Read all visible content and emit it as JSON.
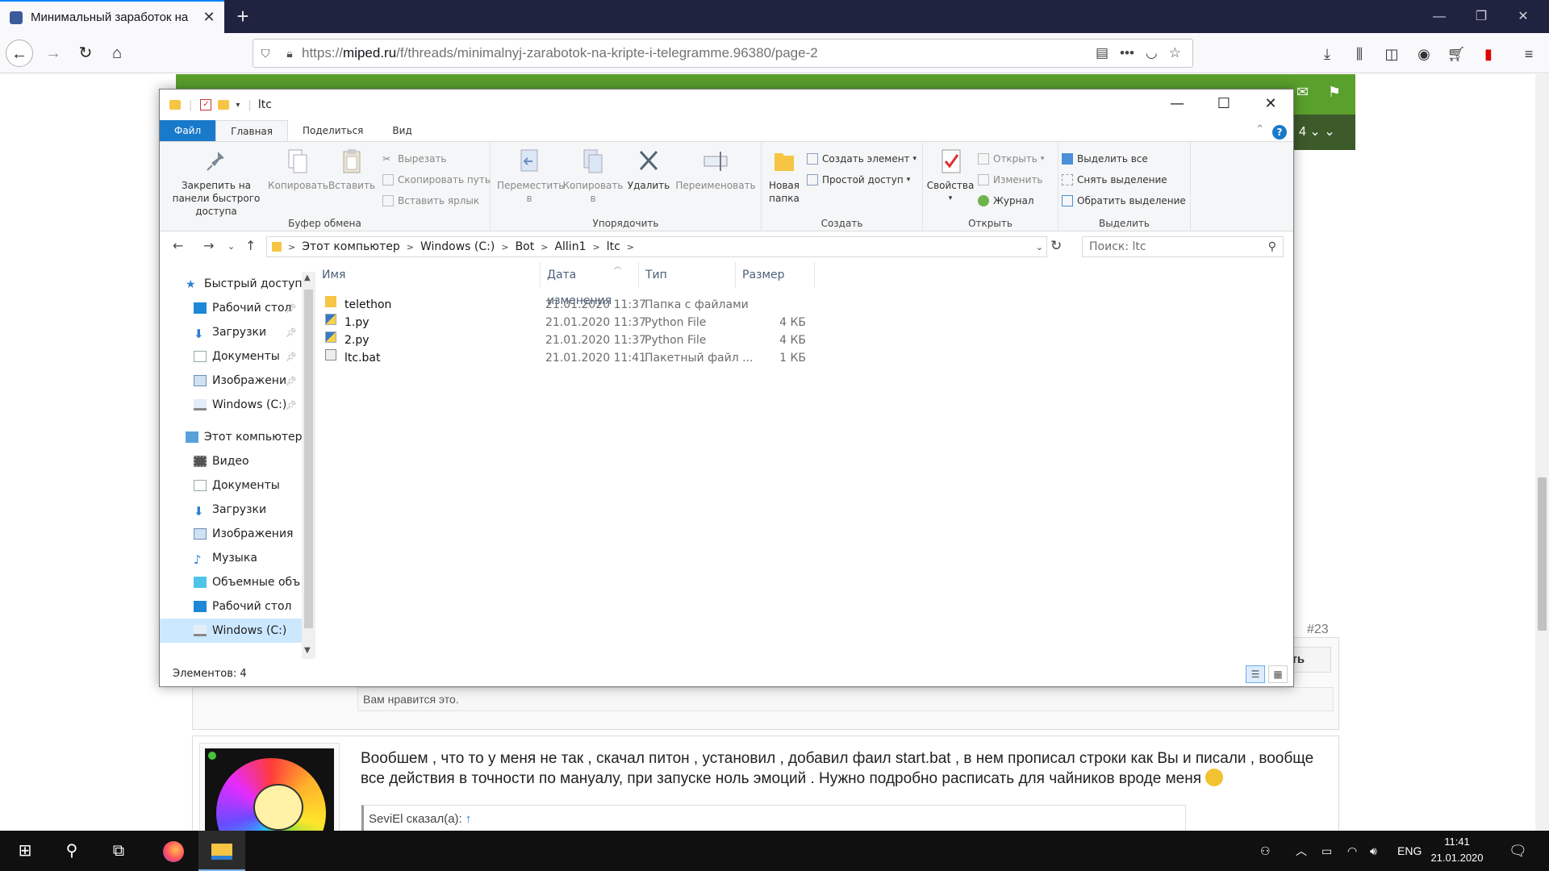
{
  "browser": {
    "tab_title": "Минимальный заработок на",
    "url_scheme": "https://",
    "url_host": "miped.ru",
    "url_path": "/f/threads/minimalnyj-zarabotok-na-kripte-i-telegramme.96380/page-2",
    "accent_color": "#0a84ff"
  },
  "webpage": {
    "pagination": "4",
    "post_number": "#23",
    "reply_label": "тить",
    "likes_text": "Вам нравится это.",
    "post_text": "Вообшем , что то у меня не так , скачал питон , установил , добавил фаил start.bat , в нем прописал строки как Вы и писали , вообще все действия в точности по мануалу, при запуске ноль эмоций . Нужно подробно расписать для чайников вроде меня",
    "quote_author": "SeviEl сказал(а):",
    "quote_arrow": "↑",
    "forum_green": "#5aa02c"
  },
  "explorer": {
    "title": "ltc",
    "tabs": [
      "Файл",
      "Главная",
      "Поделиться",
      "Вид"
    ],
    "ribbon": {
      "clipboard": {
        "label": "Буфер обмена",
        "pin": "Закрепить на панели быстрого доступа",
        "copy": "Копировать",
        "paste": "Вставить",
        "cut": "Вырезать",
        "copy_path": "Скопировать путь",
        "paste_shortcut": "Вставить ярлык"
      },
      "organize": {
        "label": "Упорядочить",
        "move": "Переместить в",
        "copy_to": "Копировать в",
        "delete": "Удалить",
        "rename": "Переименовать"
      },
      "create": {
        "label": "Создать",
        "new_folder": "Новая папка",
        "new_item": "Создать элемент",
        "easy_access": "Простой доступ"
      },
      "open": {
        "label": "Открыть",
        "properties": "Свойства",
        "open": "Открыть",
        "edit": "Изменить",
        "history": "Журнал"
      },
      "select": {
        "label": "Выделить",
        "select_all": "Выделить все",
        "select_none": "Снять выделение",
        "invert": "Обратить выделение"
      }
    },
    "breadcrumb": [
      "Этот компьютер",
      "Windows (C:)",
      "Bot",
      "Allin1",
      "ltc"
    ],
    "search_placeholder": "Поиск: ltc",
    "nav": {
      "quick_access": "Быстрый доступ",
      "quick_items": [
        "Рабочий стол",
        "Загрузки",
        "Документы",
        "Изображени",
        "Windows (C:)"
      ],
      "this_pc": "Этот компьютер",
      "pc_items": [
        "Видео",
        "Документы",
        "Загрузки",
        "Изображения",
        "Музыка",
        "Объемные объ",
        "Рабочий стол",
        "Windows (C:)"
      ]
    },
    "columns": [
      "Имя",
      "Дата изменения",
      "Тип",
      "Размер"
    ],
    "files": [
      {
        "name": "telethon",
        "date": "21.01.2020 11:37",
        "type": "Папка с файлами",
        "size": "",
        "icon": "folder-icon"
      },
      {
        "name": "1.py",
        "date": "21.01.2020 11:37",
        "type": "Python File",
        "size": "4 КБ",
        "icon": "python-file-icon"
      },
      {
        "name": "2.py",
        "date": "21.01.2020 11:37",
        "type": "Python File",
        "size": "4 КБ",
        "icon": "python-file-icon"
      },
      {
        "name": "ltc.bat",
        "date": "21.01.2020 11:41",
        "type": "Пакетный файл ...",
        "size": "1 КБ",
        "icon": "batch-file-icon"
      }
    ],
    "status": "Элементов: 4",
    "file_tab_color": "#1979ca"
  },
  "taskbar": {
    "lang": "ENG",
    "time": "11:41",
    "date": "21.01.2020"
  }
}
